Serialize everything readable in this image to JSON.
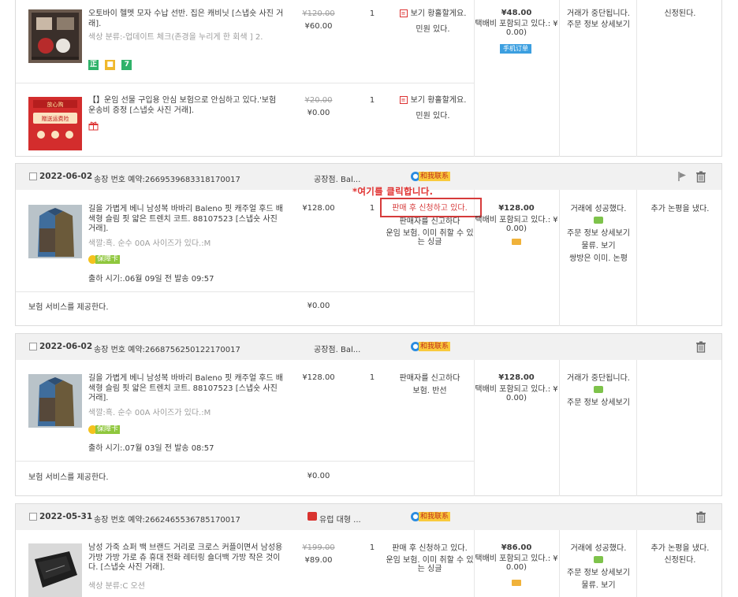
{
  "annotation": {
    "text": "*여기를 클릭합니다."
  },
  "order1": {
    "product1": {
      "title": "오토바이 헬멧 모자 수납 선반. 집은 캐비닛 [스냅숏 사진 거래].",
      "attr": "색상 분류:-업데이트 체크(존경을 누리게 한 회색 ] 2.",
      "badges": [
        "正",
        "",
        "7"
      ],
      "price_old": "¥120.00",
      "price": "¥60.00",
      "qty": "1",
      "action": "보기 황홀할게요.",
      "action2": "민원 있다."
    },
    "product2": {
      "title": "【】운임 선물 구입용 안심 보험으로 안심하고 있다.'보험 운송비 증정 [스냅숏 사진 거래].",
      "price_old": "¥20.00",
      "price": "¥0.00",
      "qty": "1",
      "action": "보기 황홀할게요.",
      "action2": "민원 있다."
    },
    "total": "¥48.00",
    "total_note": "택배비 포함되고 있다.: ¥ 0.00)",
    "mobile_tag": "手机订单",
    "status": "거래가 중단됩니다.",
    "detail_link": "주문 정보 상세보기",
    "other": "신정된다."
  },
  "order2": {
    "date": "2022-06-02",
    "order_no": "송장 번호 예약:2669539683318170017",
    "shop": "공장점. Bal...",
    "chat_label": "和我联系",
    "product": {
      "title": "길을 가볍게 베니 남성복 바바리 Baleno 핏 캐주얼 후드 배색형 슬림 핏 얇은 트렌치 코트. 88107523 [스냅숏 사진 거래].",
      "attr": "색깔:흑. 순수 00A  사이즈가 있다.:M",
      "guarantee": "保障卡",
      "ship": "출하 시기:.06월 09일 전 발송 09:57",
      "price": "¥128.00",
      "qty": "1",
      "action": "판매 후 신청하고 있다.",
      "action2": "판매자를 신고하다",
      "action3": "운임 보험. 이미 취할 수 있는 싱글"
    },
    "insurance": "보험 서비스를 제공한다.",
    "insurance_price": "¥0.00",
    "total": "¥128.00",
    "total_note": "택배비 포함되고 있다.: ¥ 0.00)",
    "status": "거래에 성공했다.",
    "detail_link": "주문 정보 상세보기",
    "logistics": "물류. 보기",
    "review": "쌍방은 이미. 논평",
    "other": "추가 논평을 냈다."
  },
  "order3": {
    "date": "2022-06-02",
    "order_no": "송장 번호 예약:2668756250122170017",
    "shop": "공장점. Bal...",
    "chat_label": "和我联系",
    "product": {
      "title": "길을 가볍게 베니 남성복 바바리 Baleno 핏 캐주얼 후드 배색형 슬림 핏 얇은 트렌치 코트. 88107523 [스냅숏 사진 거래].",
      "attr": "색깔:흑. 순수 00A  사이즈가 있다.:M",
      "guarantee": "保障卡",
      "ship": "출하 시기:.07월 03일 전 발송 08:57",
      "price": "¥128.00",
      "qty": "1",
      "action": "판매자를 신고하다",
      "action2": "보험. 반선"
    },
    "insurance": "보험 서비스를 제공한다.",
    "insurance_price": "¥0.00",
    "total": "¥128.00",
    "total_note": "택배비 포함되고 있다.: ¥ 0.00)",
    "status": "거래가 중단됩니다.",
    "detail_link": "주문 정보 상세보기"
  },
  "order4": {
    "date": "2022-05-31",
    "order_no": "송장 번호 예약:2662465536785170017",
    "shop": "유럽 대형 ...",
    "chat_label": "和我联系",
    "product": {
      "title": "남성 가죽 쇼퍼 백 브랜드 거리로 크로스 커플이면서 남성용 가방 가방 가로 츄 휴대 전화 레터링 숄더백 가방 작은 것이다. [스냅숏 사진 거래].",
      "attr": "색상 분류:C 오션",
      "price_old": "¥199.00",
      "price": "¥89.00",
      "qty": "1",
      "action": "판매 후 신청하고 있다.",
      "action2": "운임 보험. 이미 취할 수 있는 싱글"
    },
    "total": "¥86.00",
    "total_note": "택배비 포함되고 있다.: ¥ 0.00)",
    "status": "거래에 성공했다.",
    "detail_link": "주문 정보 상세보기",
    "logistics": "물류. 보기",
    "other": "추가 논평을 냈다.",
    "other2": "신정된다."
  },
  "colors": {
    "accent_red": "#d63b3b",
    "tag_yellow": "#f9ca3c",
    "chat_blue": "#2a8ce0"
  }
}
